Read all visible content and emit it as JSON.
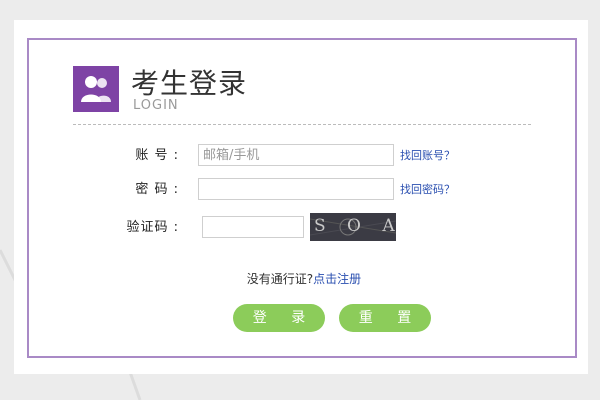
{
  "header": {
    "title": "考生登录",
    "subtitle": "LOGIN",
    "logo_icon": "users-icon",
    "accent": "#7e43a5"
  },
  "form": {
    "account": {
      "label": "账 号 :",
      "placeholder": "邮箱/手机",
      "value": "",
      "forgot_link": "找回账号？"
    },
    "password": {
      "label": "密 码 :",
      "value": "",
      "forgot_link": "找回密码？"
    },
    "captcha": {
      "label": "验证码 :",
      "value": "",
      "image_text": "S O A J"
    }
  },
  "register": {
    "text": "没有通行证?",
    "link": "点击注册"
  },
  "buttons": {
    "login": "登 录",
    "reset": "重 置",
    "color": "#8ccc5a"
  },
  "colors": {
    "border": "#a98ac6",
    "link": "#2a4fb0"
  }
}
